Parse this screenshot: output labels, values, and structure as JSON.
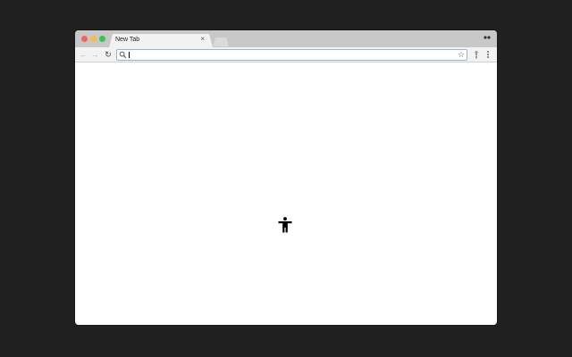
{
  "tab": {
    "title": "New Tab",
    "close_glyph": "×"
  },
  "toolbar": {
    "back_glyph": "←",
    "forward_glyph": "→",
    "reload_glyph": "↻",
    "star_glyph": "☆",
    "omnibox_value": ""
  },
  "colors": {
    "desktop_bg": "#202020",
    "titlebar_bg": "#c8c8c8",
    "tab_bg": "#f2f2f2",
    "close_light": "#fc605c",
    "minimize_light": "#fdbc40",
    "maximize_light": "#34c84a",
    "omnibox_border": "#8fb4e8"
  },
  "icons": {
    "content": "accessibility-icon",
    "search": "search-icon",
    "extension": "extension-icon",
    "menu": "menu-icon",
    "profile": "profile-icon"
  }
}
